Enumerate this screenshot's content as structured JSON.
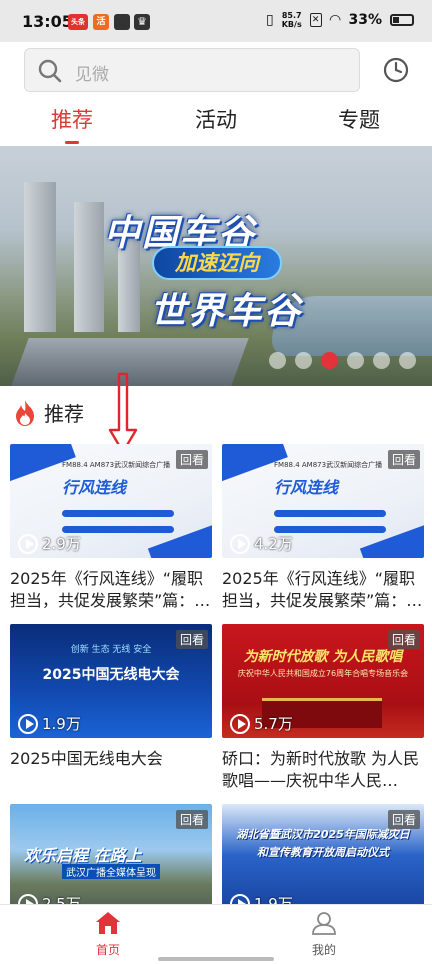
{
  "status_bar": {
    "time": "13:05",
    "app_badge_1": "头条",
    "app_badge_2": "活",
    "net_speed_value": "85.7",
    "net_speed_unit": "KB/s",
    "battery": "33%"
  },
  "search": {
    "placeholder": "见微"
  },
  "tabs": [
    {
      "label": "推荐",
      "active": true
    },
    {
      "label": "活动",
      "active": false
    },
    {
      "label": "专题",
      "active": false
    }
  ],
  "banner": {
    "title_line_1": "中国车谷",
    "slogan": "加速迈向",
    "title_line_2": "世界车谷",
    "page_count": 6,
    "active_page": 3
  },
  "section": {
    "title": "推荐"
  },
  "replay_label": "回看",
  "cards": [
    {
      "views": "2.9万",
      "title": "2025年《行风连线》“履职担当，共促发展繁荣”篇：…",
      "thumb_logo": "行风连线",
      "thumb_mini": "FM88.4 AM873武汉新闻综合广播",
      "style": "white"
    },
    {
      "views": "4.2万",
      "title": "2025年《行风连线》“履职担当，共促发展繁荣”篇：…",
      "thumb_logo": "行风连线",
      "thumb_mini": "FM88.4 AM873武汉新闻综合广播",
      "style": "white"
    },
    {
      "views": "1.9万",
      "title": "2025中国无线电大会",
      "thumb_top": "创新 生态 无线 安全",
      "thumb_title": "2025中国无线电大会",
      "style": "blue"
    },
    {
      "views": "5.7万",
      "title": "硚口：为新时代放歌 为人民歌唱——庆祝中华人民…",
      "thumb_title": "为新时代放歌 为人民歌唱",
      "thumb_sub": "庆祝中华人民共和国成立76周年合唱专场音乐会",
      "style": "red"
    },
    {
      "views": "2.5万",
      "title": "",
      "thumb_title": "欢乐启程 在路上",
      "thumb_sub": "武汉广播全媒体呈现",
      "style": "road"
    },
    {
      "views": "1.9万",
      "title": "",
      "thumb_title": "湖北省暨武汉市2025年国际减灾日",
      "thumb_sub": "和宣传教育开放周启动仪式",
      "style": "blue2"
    }
  ],
  "bottom_nav": [
    {
      "label": "首页",
      "active": true
    },
    {
      "label": "我的",
      "active": false
    }
  ],
  "colors": {
    "accent": "#d93a36",
    "banner_pill": "#0d47a1"
  }
}
